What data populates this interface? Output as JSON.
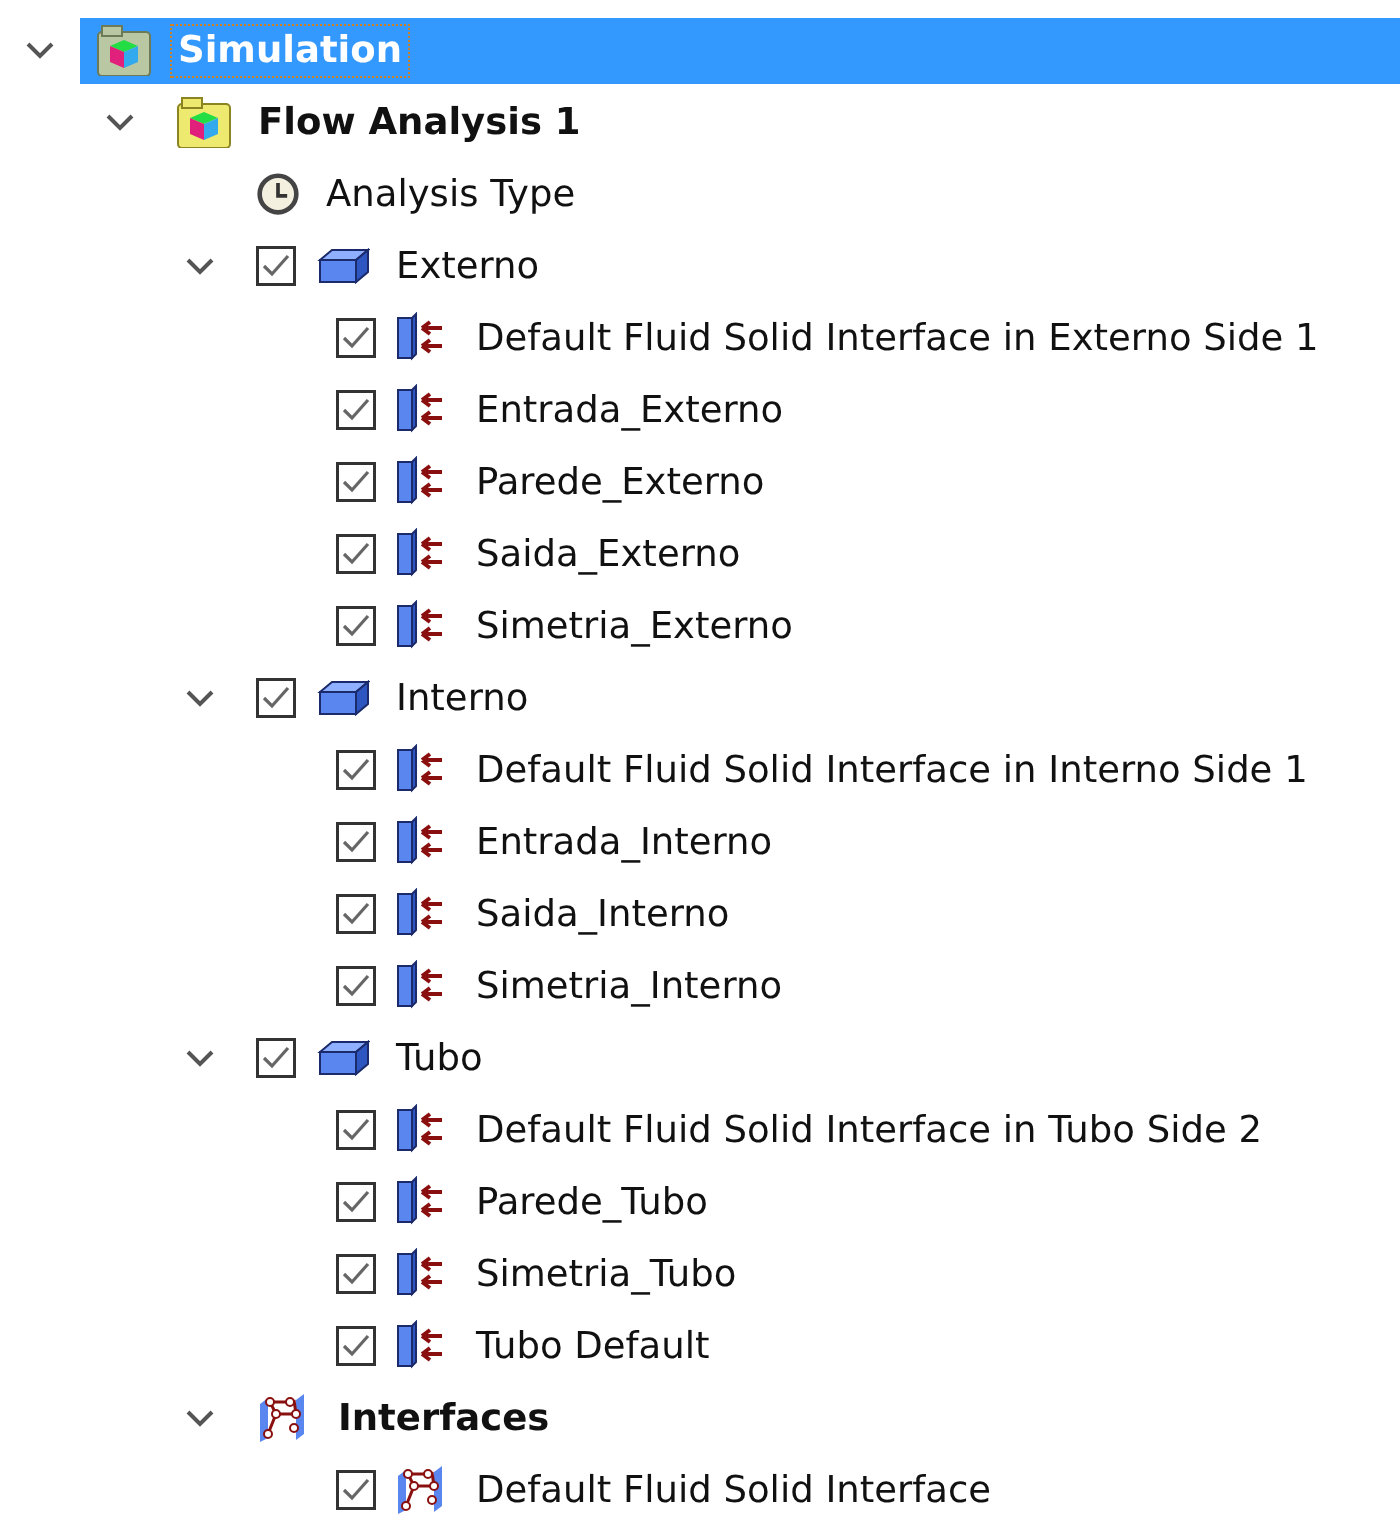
{
  "tree": [
    {
      "kind": "simulation",
      "label": "Simulation",
      "expanded": true,
      "selected": true,
      "children": [
        {
          "kind": "analysis",
          "label": "Flow Analysis 1",
          "expanded": true,
          "selected": false,
          "children": [
            {
              "kind": "clock",
              "label": "Analysis Type",
              "selected": false
            },
            {
              "kind": "body",
              "label": "Externo",
              "expanded": true,
              "checked": true,
              "selected": false,
              "children": [
                {
                  "kind": "boundary",
                  "label": "Default Fluid Solid Interface in Externo Side 1",
                  "checked": true,
                  "selected": false
                },
                {
                  "kind": "boundary",
                  "label": "Entrada_Externo",
                  "checked": true,
                  "selected": false
                },
                {
                  "kind": "boundary",
                  "label": "Parede_Externo",
                  "checked": true,
                  "selected": false
                },
                {
                  "kind": "boundary",
                  "label": "Saida_Externo",
                  "checked": true,
                  "selected": false
                },
                {
                  "kind": "boundary",
                  "label": "Simetria_Externo",
                  "checked": true,
                  "selected": false
                }
              ]
            },
            {
              "kind": "body",
              "label": "Interno",
              "expanded": true,
              "checked": true,
              "selected": false,
              "children": [
                {
                  "kind": "boundary",
                  "label": "Default Fluid Solid Interface in Interno Side 1",
                  "checked": true,
                  "selected": false
                },
                {
                  "kind": "boundary",
                  "label": "Entrada_Interno",
                  "checked": true,
                  "selected": false
                },
                {
                  "kind": "boundary",
                  "label": "Saida_Interno",
                  "checked": true,
                  "selected": false
                },
                {
                  "kind": "boundary",
                  "label": "Simetria_Interno",
                  "checked": true,
                  "selected": false
                }
              ]
            },
            {
              "kind": "body",
              "label": "Tubo",
              "expanded": true,
              "checked": true,
              "selected": false,
              "children": [
                {
                  "kind": "boundary",
                  "label": "Default Fluid Solid Interface in Tubo Side 2",
                  "checked": true,
                  "selected": false
                },
                {
                  "kind": "boundary",
                  "label": "Parede_Tubo",
                  "checked": true,
                  "selected": false
                },
                {
                  "kind": "boundary",
                  "label": "Simetria_Tubo",
                  "checked": true,
                  "selected": false
                },
                {
                  "kind": "boundary",
                  "label": "Tubo Default",
                  "checked": true,
                  "selected": false
                }
              ]
            },
            {
              "kind": "interfaces",
              "label": "Interfaces",
              "expanded": true,
              "selected": false,
              "children": [
                {
                  "kind": "interface",
                  "label": "Default Fluid Solid Interface",
                  "checked": true,
                  "selected": false
                }
              ]
            }
          ]
        }
      ]
    }
  ]
}
